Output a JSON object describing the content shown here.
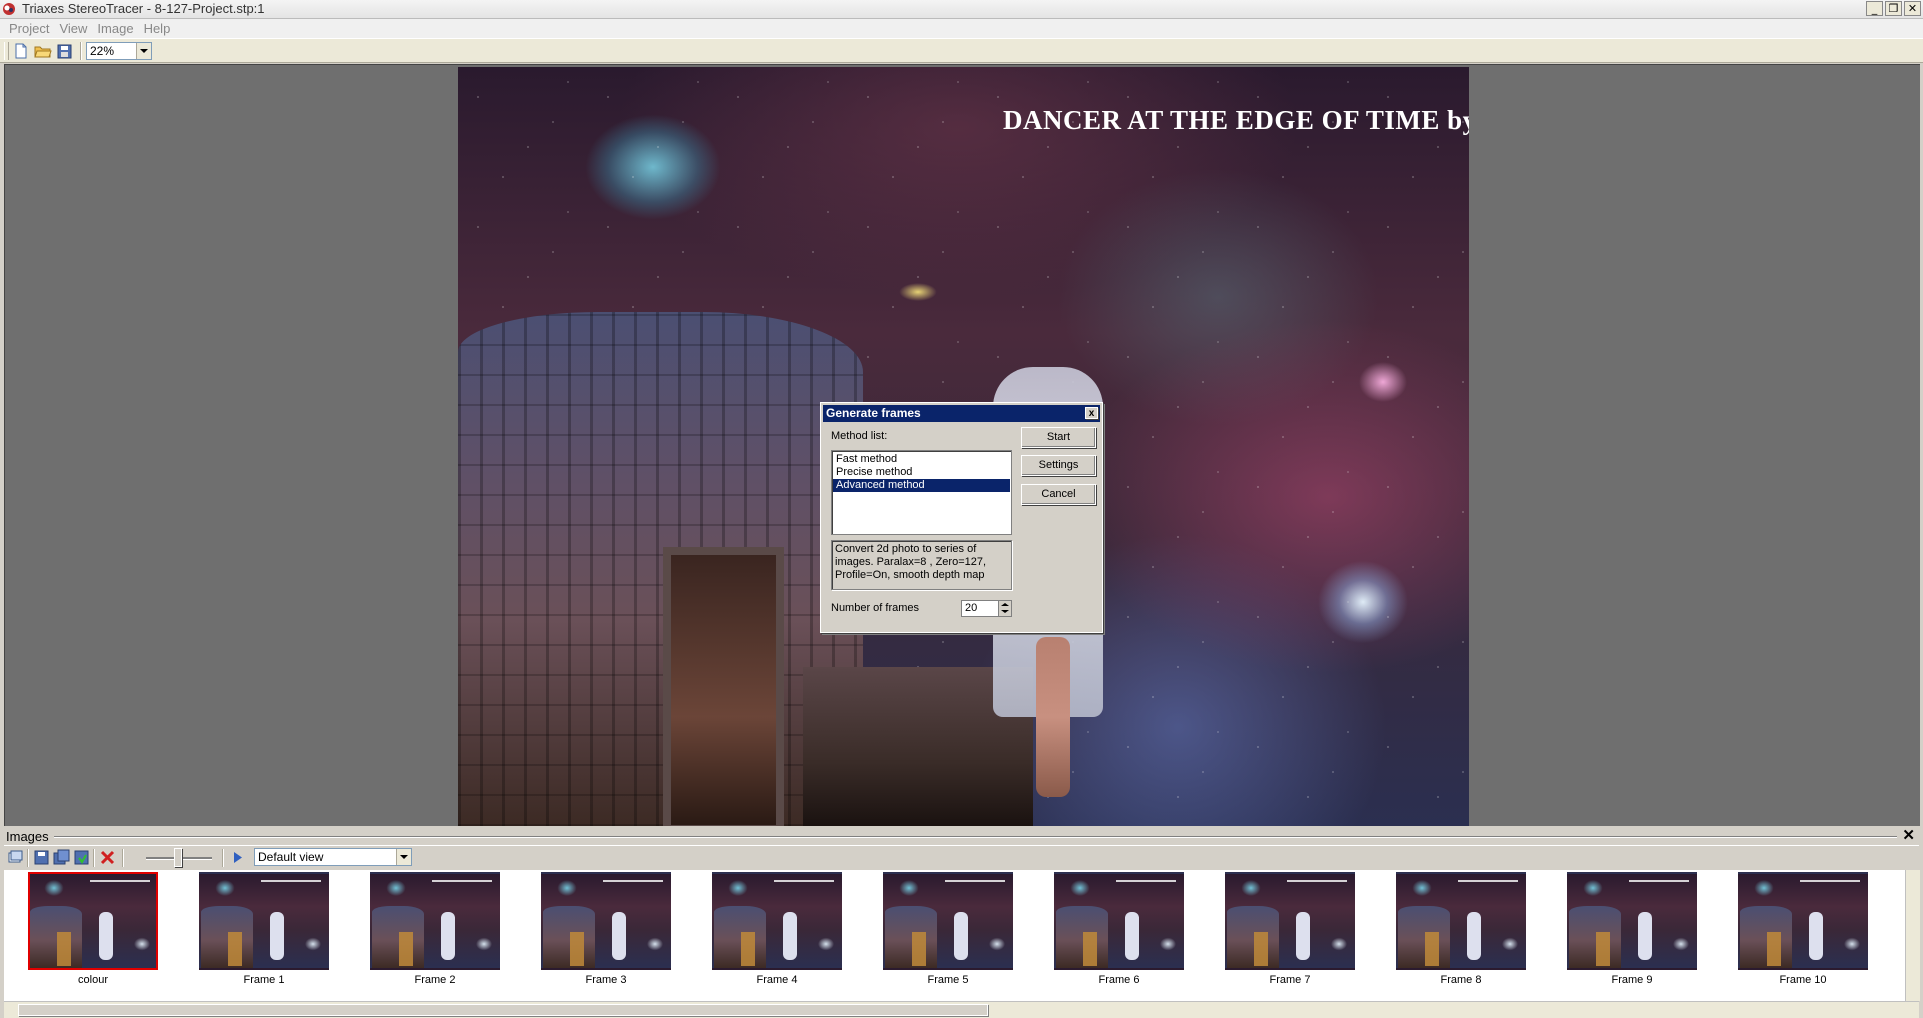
{
  "window": {
    "title": "Triaxes StereoTracer - 8-127-Project.stp:1",
    "minimize_glyph": "_",
    "maximize_glyph": "❐",
    "close_glyph": "✕"
  },
  "menu": [
    "Project",
    "View",
    "Image",
    "Help"
  ],
  "toolbar": {
    "zoom_value": "22%",
    "icons": [
      "new-document-icon",
      "open-folder-icon",
      "save-project-icon"
    ]
  },
  "canvas": {
    "image_title": "DANCER AT THE EDGE OF TIME by Mol"
  },
  "dialog": {
    "title": "Generate frames",
    "close_glyph": "x",
    "method_list_label": "Method list:",
    "methods": [
      {
        "label": "Fast method",
        "selected": false
      },
      {
        "label": "Precise method",
        "selected": false
      },
      {
        "label": "Advanced method",
        "selected": true
      }
    ],
    "description": "Convert 2d photo to series of images. Paralax=8  , Zero=127, Profile=On, smooth depth map",
    "frames_label": "Number of frames",
    "frames_value": "20",
    "buttons": {
      "start": "Start",
      "settings": "Settings",
      "cancel": "Cancel"
    }
  },
  "images_panel": {
    "title": "Images",
    "close_glyph": "✕",
    "view_select": "Default view",
    "thumbnails": [
      "colour",
      "Frame 1",
      "Frame 2",
      "Frame 3",
      "Frame 4",
      "Frame 5",
      "Frame 6",
      "Frame 7",
      "Frame 8",
      "Frame 9",
      "Frame 10"
    ],
    "active_index": 0
  },
  "colors": {
    "dialog_title_bg": "#0a246a",
    "selection_bg": "#0a246a",
    "active_thumb_border": "#e00000",
    "workspace_bg": "#6f6f6f"
  }
}
